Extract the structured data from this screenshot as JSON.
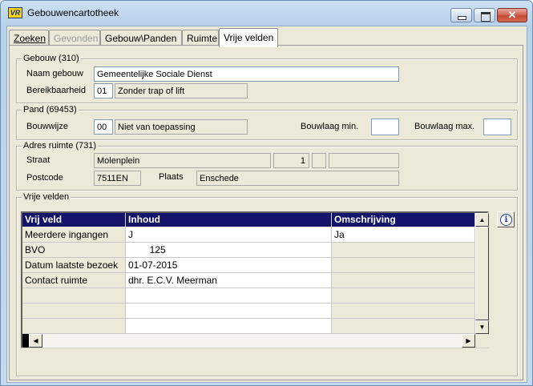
{
  "window": {
    "title": "Gebouwencartotheek",
    "app_icon_text": "VR",
    "close_glyph": "✕"
  },
  "tabs": [
    {
      "label": "Zoeken",
      "state": "normal"
    },
    {
      "label": "Gevonden",
      "state": "disabled"
    },
    {
      "label": "Gebouw\\Panden",
      "state": "normal"
    },
    {
      "label": "Ruimte",
      "state": "normal"
    },
    {
      "label": "Vrije velden",
      "state": "active"
    }
  ],
  "gebouw": {
    "legend": "Gebouw (310)",
    "naam_label": "Naam gebouw",
    "naam_value": "Gemeentelijke Sociale Dienst",
    "bereik_label": "Bereikbaarheid",
    "bereik_code": "01",
    "bereik_text": "Zonder trap of lift"
  },
  "pand": {
    "legend": "Pand (69453)",
    "bouwwijze_label": "Bouwwijze",
    "bouwwijze_code": "00",
    "bouwwijze_text": "Niet van toepassing",
    "bouwlaag_min_label": "Bouwlaag min.",
    "bouwlaag_min_value": "",
    "bouwlaag_max_label": "Bouwlaag max.",
    "bouwlaag_max_value": ""
  },
  "adres": {
    "legend": "Adres ruimte (731)",
    "straat_label": "Straat",
    "straat_value": "Molenplein",
    "huisnummer": "1",
    "toevoeging": "",
    "extra": "",
    "postcode_label": "Postcode",
    "postcode_value": "7511EN",
    "plaats_label": "Plaats",
    "plaats_value": "Enschede"
  },
  "vrije_velden": {
    "legend": "Vrije velden",
    "columns": [
      "Vrij veld",
      "Inhoud",
      "Omschrijving"
    ],
    "rows": [
      [
        "Meerdere ingangen",
        "J",
        "Ja"
      ],
      [
        "BVO",
        "        125",
        ""
      ],
      [
        "Datum laatste bezoek",
        "01-07-2015",
        ""
      ],
      [
        "Contact ruimte",
        "dhr. E.C.V. Meerman",
        ""
      ]
    ],
    "scroll_up": "▲",
    "scroll_down": "▼",
    "scroll_left": "◀",
    "scroll_right": "▶",
    "info_icon_glyph": "i"
  }
}
